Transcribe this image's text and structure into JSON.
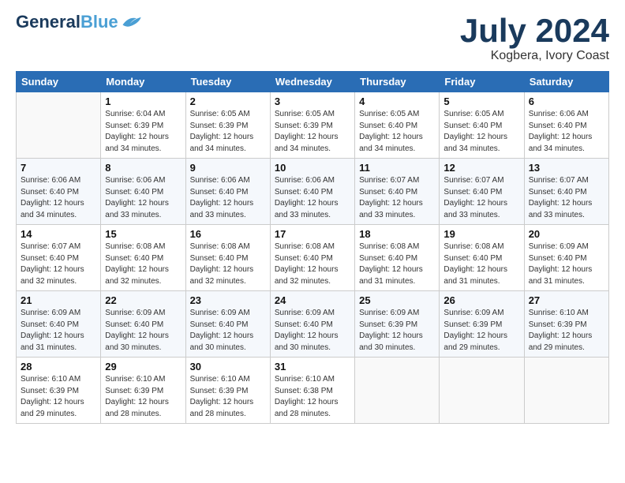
{
  "header": {
    "logo_line1": "General",
    "logo_line2": "Blue",
    "month": "July 2024",
    "location": "Kogbera, Ivory Coast"
  },
  "days_of_week": [
    "Sunday",
    "Monday",
    "Tuesday",
    "Wednesday",
    "Thursday",
    "Friday",
    "Saturday"
  ],
  "weeks": [
    [
      {
        "day": "",
        "sunrise": "",
        "sunset": "",
        "daylight": ""
      },
      {
        "day": "1",
        "sunrise": "Sunrise: 6:04 AM",
        "sunset": "Sunset: 6:39 PM",
        "daylight": "Daylight: 12 hours and 34 minutes."
      },
      {
        "day": "2",
        "sunrise": "Sunrise: 6:05 AM",
        "sunset": "Sunset: 6:39 PM",
        "daylight": "Daylight: 12 hours and 34 minutes."
      },
      {
        "day": "3",
        "sunrise": "Sunrise: 6:05 AM",
        "sunset": "Sunset: 6:39 PM",
        "daylight": "Daylight: 12 hours and 34 minutes."
      },
      {
        "day": "4",
        "sunrise": "Sunrise: 6:05 AM",
        "sunset": "Sunset: 6:40 PM",
        "daylight": "Daylight: 12 hours and 34 minutes."
      },
      {
        "day": "5",
        "sunrise": "Sunrise: 6:05 AM",
        "sunset": "Sunset: 6:40 PM",
        "daylight": "Daylight: 12 hours and 34 minutes."
      },
      {
        "day": "6",
        "sunrise": "Sunrise: 6:06 AM",
        "sunset": "Sunset: 6:40 PM",
        "daylight": "Daylight: 12 hours and 34 minutes."
      }
    ],
    [
      {
        "day": "7",
        "sunrise": "Sunrise: 6:06 AM",
        "sunset": "Sunset: 6:40 PM",
        "daylight": "Daylight: 12 hours and 34 minutes."
      },
      {
        "day": "8",
        "sunrise": "Sunrise: 6:06 AM",
        "sunset": "Sunset: 6:40 PM",
        "daylight": "Daylight: 12 hours and 33 minutes."
      },
      {
        "day": "9",
        "sunrise": "Sunrise: 6:06 AM",
        "sunset": "Sunset: 6:40 PM",
        "daylight": "Daylight: 12 hours and 33 minutes."
      },
      {
        "day": "10",
        "sunrise": "Sunrise: 6:06 AM",
        "sunset": "Sunset: 6:40 PM",
        "daylight": "Daylight: 12 hours and 33 minutes."
      },
      {
        "day": "11",
        "sunrise": "Sunrise: 6:07 AM",
        "sunset": "Sunset: 6:40 PM",
        "daylight": "Daylight: 12 hours and 33 minutes."
      },
      {
        "day": "12",
        "sunrise": "Sunrise: 6:07 AM",
        "sunset": "Sunset: 6:40 PM",
        "daylight": "Daylight: 12 hours and 33 minutes."
      },
      {
        "day": "13",
        "sunrise": "Sunrise: 6:07 AM",
        "sunset": "Sunset: 6:40 PM",
        "daylight": "Daylight: 12 hours and 33 minutes."
      }
    ],
    [
      {
        "day": "14",
        "sunrise": "Sunrise: 6:07 AM",
        "sunset": "Sunset: 6:40 PM",
        "daylight": "Daylight: 12 hours and 32 minutes."
      },
      {
        "day": "15",
        "sunrise": "Sunrise: 6:08 AM",
        "sunset": "Sunset: 6:40 PM",
        "daylight": "Daylight: 12 hours and 32 minutes."
      },
      {
        "day": "16",
        "sunrise": "Sunrise: 6:08 AM",
        "sunset": "Sunset: 6:40 PM",
        "daylight": "Daylight: 12 hours and 32 minutes."
      },
      {
        "day": "17",
        "sunrise": "Sunrise: 6:08 AM",
        "sunset": "Sunset: 6:40 PM",
        "daylight": "Daylight: 12 hours and 32 minutes."
      },
      {
        "day": "18",
        "sunrise": "Sunrise: 6:08 AM",
        "sunset": "Sunset: 6:40 PM",
        "daylight": "Daylight: 12 hours and 31 minutes."
      },
      {
        "day": "19",
        "sunrise": "Sunrise: 6:08 AM",
        "sunset": "Sunset: 6:40 PM",
        "daylight": "Daylight: 12 hours and 31 minutes."
      },
      {
        "day": "20",
        "sunrise": "Sunrise: 6:09 AM",
        "sunset": "Sunset: 6:40 PM",
        "daylight": "Daylight: 12 hours and 31 minutes."
      }
    ],
    [
      {
        "day": "21",
        "sunrise": "Sunrise: 6:09 AM",
        "sunset": "Sunset: 6:40 PM",
        "daylight": "Daylight: 12 hours and 31 minutes."
      },
      {
        "day": "22",
        "sunrise": "Sunrise: 6:09 AM",
        "sunset": "Sunset: 6:40 PM",
        "daylight": "Daylight: 12 hours and 30 minutes."
      },
      {
        "day": "23",
        "sunrise": "Sunrise: 6:09 AM",
        "sunset": "Sunset: 6:40 PM",
        "daylight": "Daylight: 12 hours and 30 minutes."
      },
      {
        "day": "24",
        "sunrise": "Sunrise: 6:09 AM",
        "sunset": "Sunset: 6:40 PM",
        "daylight": "Daylight: 12 hours and 30 minutes."
      },
      {
        "day": "25",
        "sunrise": "Sunrise: 6:09 AM",
        "sunset": "Sunset: 6:39 PM",
        "daylight": "Daylight: 12 hours and 30 minutes."
      },
      {
        "day": "26",
        "sunrise": "Sunrise: 6:09 AM",
        "sunset": "Sunset: 6:39 PM",
        "daylight": "Daylight: 12 hours and 29 minutes."
      },
      {
        "day": "27",
        "sunrise": "Sunrise: 6:10 AM",
        "sunset": "Sunset: 6:39 PM",
        "daylight": "Daylight: 12 hours and 29 minutes."
      }
    ],
    [
      {
        "day": "28",
        "sunrise": "Sunrise: 6:10 AM",
        "sunset": "Sunset: 6:39 PM",
        "daylight": "Daylight: 12 hours and 29 minutes."
      },
      {
        "day": "29",
        "sunrise": "Sunrise: 6:10 AM",
        "sunset": "Sunset: 6:39 PM",
        "daylight": "Daylight: 12 hours and 28 minutes."
      },
      {
        "day": "30",
        "sunrise": "Sunrise: 6:10 AM",
        "sunset": "Sunset: 6:39 PM",
        "daylight": "Daylight: 12 hours and 28 minutes."
      },
      {
        "day": "31",
        "sunrise": "Sunrise: 6:10 AM",
        "sunset": "Sunset: 6:38 PM",
        "daylight": "Daylight: 12 hours and 28 minutes."
      },
      {
        "day": "",
        "sunrise": "",
        "sunset": "",
        "daylight": ""
      },
      {
        "day": "",
        "sunrise": "",
        "sunset": "",
        "daylight": ""
      },
      {
        "day": "",
        "sunrise": "",
        "sunset": "",
        "daylight": ""
      }
    ]
  ]
}
